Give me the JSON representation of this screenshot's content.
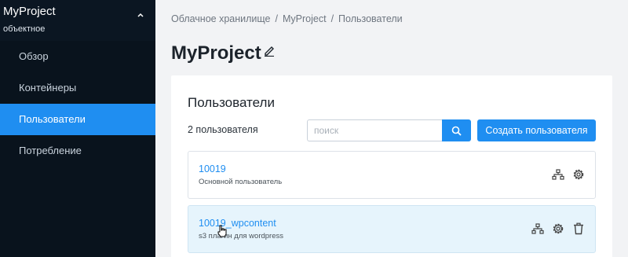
{
  "sidebar": {
    "title": "MyProject",
    "subtitle": "объектное",
    "items": [
      {
        "label": "Обзор"
      },
      {
        "label": "Контейнеры"
      },
      {
        "label": "Пользователи"
      },
      {
        "label": "Потребление"
      }
    ],
    "active_index": 2
  },
  "breadcrumb": [
    "Облачное хранилище",
    "MyProject",
    "Пользователи"
  ],
  "page_title": "MyProject",
  "card": {
    "title": "Пользователи",
    "count_label": "2 пользователя",
    "search": {
      "placeholder": "поиск",
      "value": ""
    },
    "create_button": "Создать пользователя"
  },
  "users": [
    {
      "name": "10019",
      "description": "Основной пользователь",
      "actions": [
        "hierarchy-icon",
        "gear-icon"
      ]
    },
    {
      "name": "10019_wpcontent",
      "description": "s3 плагин для wordpress",
      "actions": [
        "hierarchy-icon",
        "gear-icon",
        "trash-icon"
      ]
    }
  ],
  "colors": {
    "accent": "#1f8ef1",
    "sidebar_bg": "#0b1622",
    "highlight_row": "#e6f4fc"
  }
}
